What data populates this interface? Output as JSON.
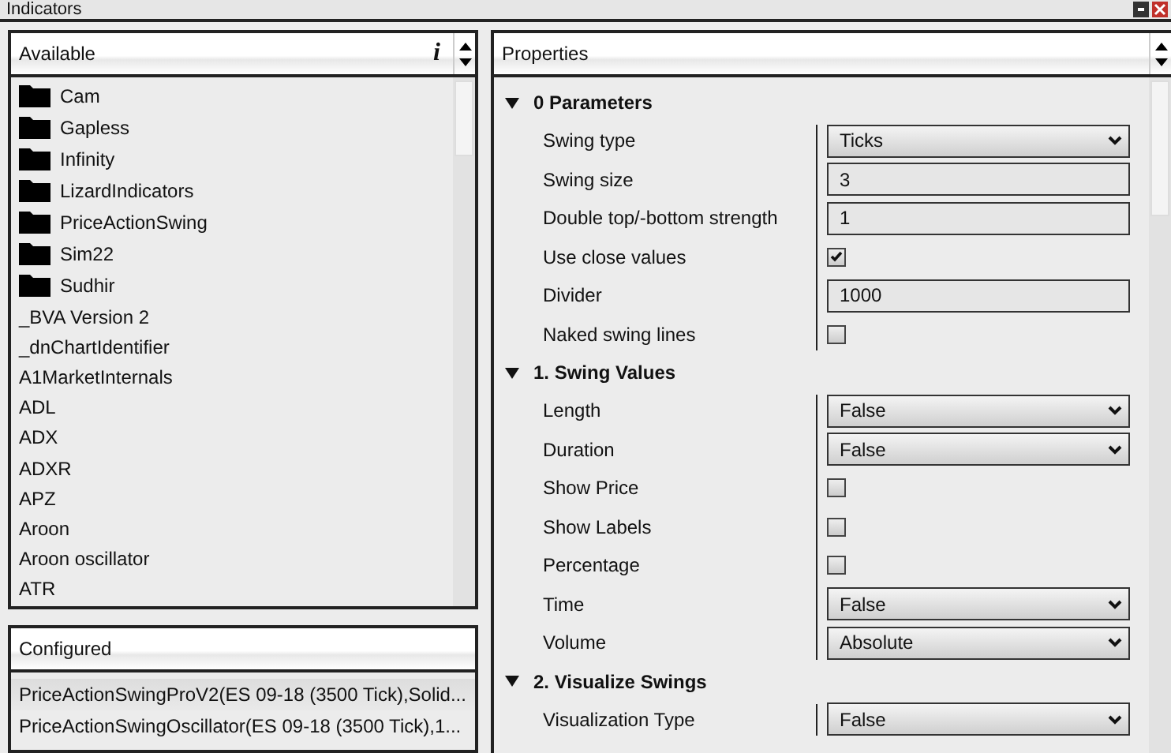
{
  "window": {
    "title": "Indicators"
  },
  "available": {
    "title": "Available",
    "info": "i",
    "folders": [
      "Cam",
      "Gapless",
      "Infinity",
      "LizardIndicators",
      "PriceActionSwing",
      "Sim22",
      "Sudhir"
    ],
    "items": [
      "_BVA Version 2",
      "_dnChartIdentifier",
      "A1MarketInternals",
      "ADL",
      "ADX",
      "ADXR",
      "APZ",
      "Aroon",
      "Aroon oscillator",
      "ATR"
    ]
  },
  "configured": {
    "title": "Configured",
    "items": [
      {
        "label": "PriceActionSwingProV2(ES 09-18 (3500 Tick),Solid...",
        "selected": true
      },
      {
        "label": "PriceActionSwingOscillator(ES 09-18 (3500 Tick),1...",
        "selected": false
      }
    ]
  },
  "properties": {
    "title": "Properties",
    "sections": [
      {
        "title": "0 Parameters",
        "expanded": true,
        "rows": [
          {
            "label": "Swing type",
            "kind": "dropdown",
            "value": "Ticks"
          },
          {
            "label": "Swing size",
            "kind": "text",
            "value": "3"
          },
          {
            "label": "Double top/-bottom strength",
            "kind": "text",
            "value": "1"
          },
          {
            "label": "Use close values",
            "kind": "checkbox",
            "checked": true
          },
          {
            "label": "Divider",
            "kind": "text",
            "value": "1000"
          },
          {
            "label": "Naked swing lines",
            "kind": "checkbox",
            "checked": false
          }
        ]
      },
      {
        "title": "1. Swing Values",
        "expanded": true,
        "rows": [
          {
            "label": "Length",
            "kind": "dropdown",
            "value": "False"
          },
          {
            "label": "Duration",
            "kind": "dropdown",
            "value": "False"
          },
          {
            "label": "Show Price",
            "kind": "checkbox",
            "checked": false
          },
          {
            "label": "Show Labels",
            "kind": "checkbox",
            "checked": false
          },
          {
            "label": "Percentage",
            "kind": "checkbox",
            "checked": false
          },
          {
            "label": "Time",
            "kind": "dropdown",
            "value": "False"
          },
          {
            "label": "Volume",
            "kind": "dropdown",
            "value": "Absolute"
          }
        ]
      },
      {
        "title": "2. Visualize Swings",
        "expanded": true,
        "rows": [
          {
            "label": "Visualization Type",
            "kind": "dropdown",
            "value": "False"
          }
        ]
      }
    ]
  }
}
